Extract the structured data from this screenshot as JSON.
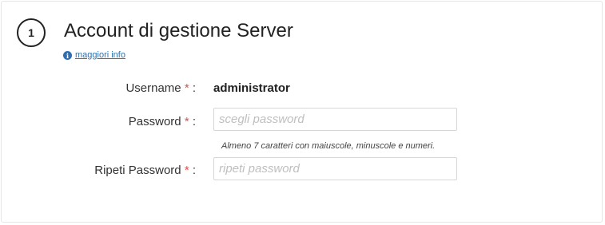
{
  "section": {
    "step_number": "1",
    "title": "Account di gestione Server",
    "more_info_label": "maggiori info"
  },
  "form": {
    "username": {
      "label": "Username",
      "required_mark": "*",
      "separator": ":",
      "value": "administrator"
    },
    "password": {
      "label": "Password",
      "required_mark": "*",
      "separator": ":",
      "placeholder": "scegli password",
      "hint": "Almeno 7 caratteri con maiuscole, minuscole e numeri."
    },
    "repeat_password": {
      "label": "Ripeti Password",
      "required_mark": "*",
      "separator": ":",
      "placeholder": "ripeti password"
    }
  },
  "colors": {
    "link": "#2f6fb0",
    "required": "#d9534f",
    "border": "#d6d6d6"
  },
  "icons": {
    "info": "info-circle-icon"
  }
}
